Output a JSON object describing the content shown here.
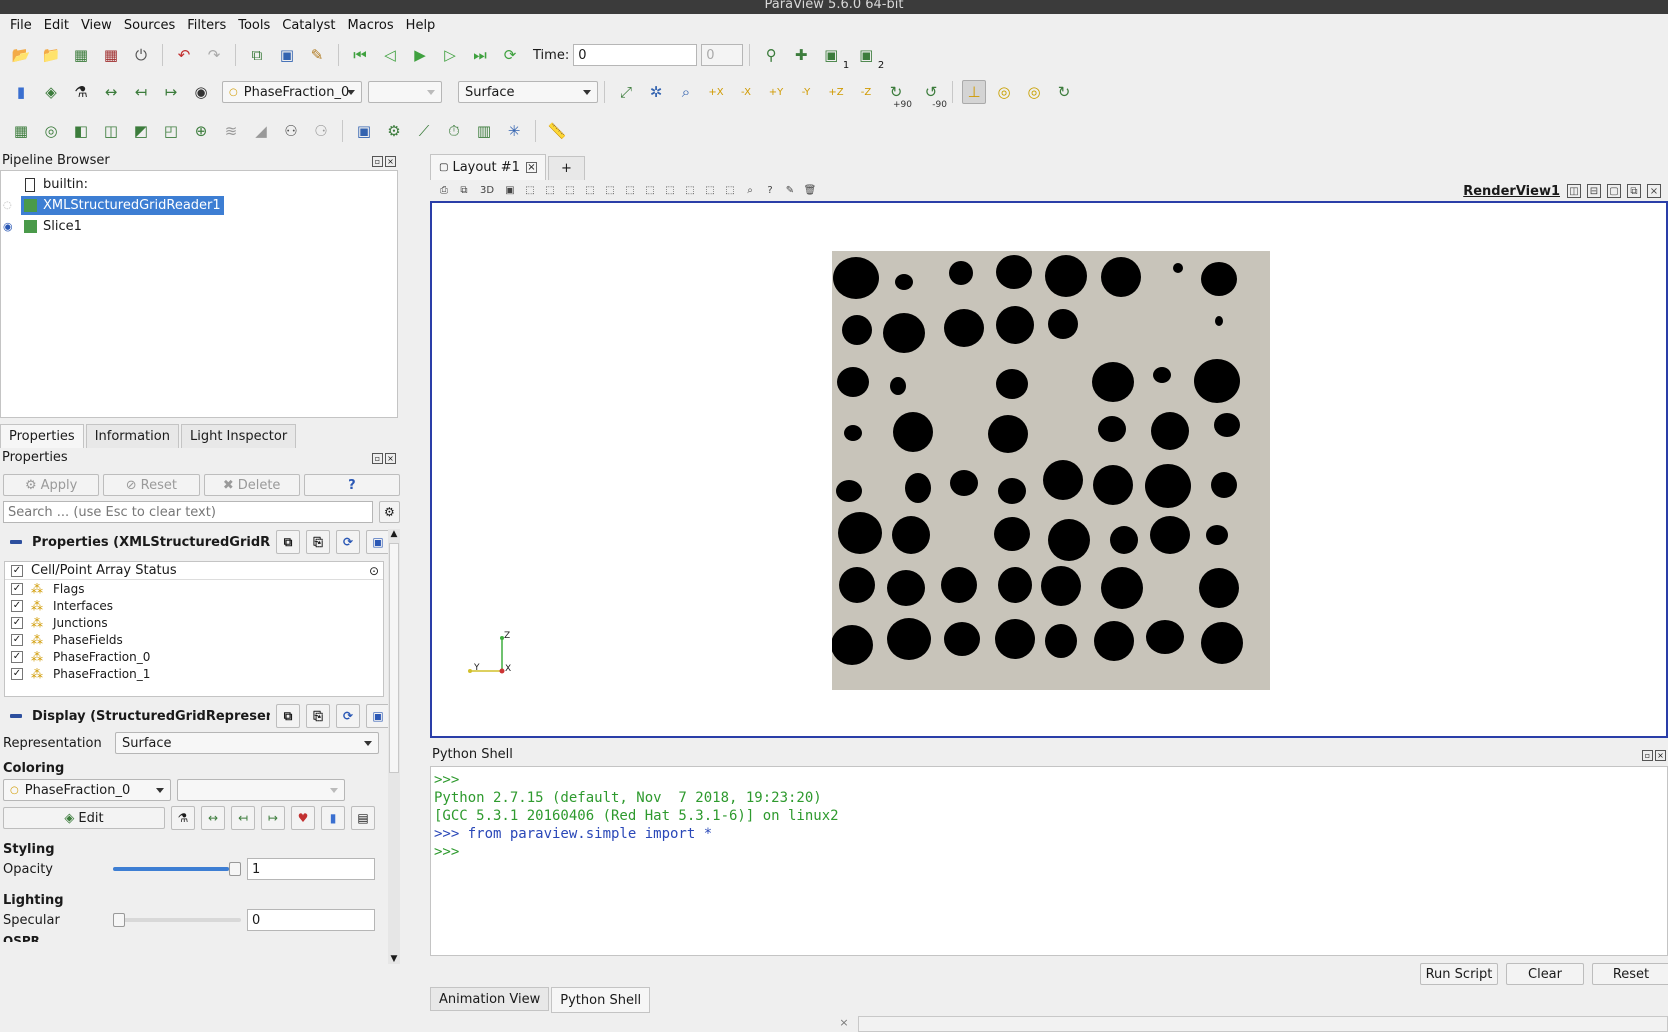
{
  "window": {
    "title": "ParaView 5.6.0 64-bit"
  },
  "menu": [
    "File",
    "Edit",
    "View",
    "Sources",
    "Filters",
    "Tools",
    "Catalyst",
    "Macros",
    "Help"
  ],
  "toolbar1": {
    "time_label": "Time:",
    "time_value": "0",
    "time_index": "0",
    "loc_labels": [
      "1",
      "2"
    ]
  },
  "toolbar2": {
    "color_array": "PhaseFraction_0",
    "component": "",
    "representation": "Surface",
    "rotate_plus": "+90",
    "rotate_minus": "-90",
    "axis_labels": [
      "+X",
      "-X",
      "+Y",
      "-Y",
      "+Z",
      "-Z"
    ]
  },
  "pipeline": {
    "title": "Pipeline Browser",
    "items": [
      {
        "label": "builtin:"
      },
      {
        "label": "XMLStructuredGridReader1"
      },
      {
        "label": "Slice1"
      }
    ]
  },
  "tabs": [
    "Properties",
    "Information",
    "Light Inspector"
  ],
  "properties": {
    "title": "Properties",
    "apply": "Apply",
    "reset": "Reset",
    "delete": "Delete",
    "help": "?",
    "search_placeholder": "Search ... (use Esc to clear text)",
    "section_props": "Properties (XMLStructuredGridRe",
    "array_header": "Cell/Point Array Status",
    "arrays": [
      "Flags",
      "Interfaces",
      "Junctions",
      "PhaseFields",
      "PhaseFraction_0",
      "PhaseFraction_1"
    ],
    "section_display": "Display (StructuredGridRepresen",
    "representation_label": "Representation",
    "representation_value": "Surface",
    "coloring_label": "Coloring",
    "coloring_value": "PhaseFraction_0",
    "coloring_component": "",
    "edit": "Edit",
    "styling_label": "Styling",
    "opacity_label": "Opacity",
    "opacity_value": "1",
    "opacity_level": 1.0,
    "lighting_label": "Lighting",
    "specular_label": "Specular",
    "specular_value": "0",
    "specular_level": 0.0,
    "cut_label": "OSPR"
  },
  "layout": {
    "tab": "Layout #1",
    "add": "+",
    "toolbar_3d": "3D",
    "view_name": "RenderView1"
  },
  "axes": {
    "z": "Z",
    "y": "Y",
    "x": "X"
  },
  "python": {
    "title": "Python Shell",
    "lines": [
      ">>> ",
      "Python 2.7.15 (default, Nov  7 2018, 19:23:20)",
      "[GCC 5.3.1 20160406 (Red Hat 5.3.1-6)] on linux2",
      ">>> from paraview.simple import *",
      ">>> "
    ],
    "run_script": "Run Script",
    "clear": "Clear",
    "reset": "Reset"
  },
  "bottom_tabs": [
    "Animation View",
    "Python Shell"
  ],
  "colors": {
    "selection": "#3d7ed3",
    "view_border": "#2a3ea8",
    "slice_bg": "#c8c4ba",
    "python_text": "#2e9a2e"
  }
}
